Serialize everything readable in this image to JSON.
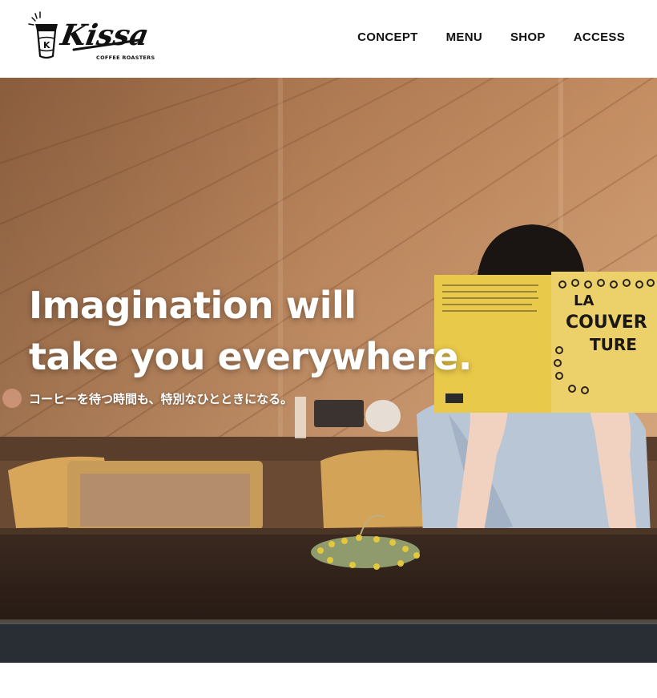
{
  "brand": {
    "name": "Kissa",
    "tagline": "COFFEE ROASTERS",
    "cup_letter": "K"
  },
  "nav": {
    "items": [
      {
        "label": "CONCEPT"
      },
      {
        "label": "MENU"
      },
      {
        "label": "SHOP"
      },
      {
        "label": "ACCESS"
      }
    ]
  },
  "hero": {
    "headline_line1": "Imagination will",
    "headline_line2": "take you everywhere.",
    "subline": "コーヒーを待つ時間も、特別なひとときになる。",
    "book_title_line1": "LA",
    "book_title_line2": "COUVER",
    "book_title_line3": "TURE"
  },
  "colors": {
    "text_dark": "#111111",
    "hero_text": "#ffffff",
    "book_yellow": "#e9c94a",
    "wood": "#b27a50"
  }
}
